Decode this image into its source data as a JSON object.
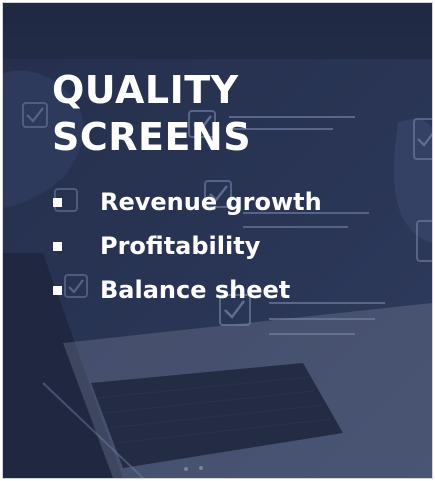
{
  "card": {
    "title_line1": "QUALITY",
    "title_line2": "SCREENS",
    "bullets": [
      "Revenue growth",
      "Profitability",
      "Balance sheet"
    ]
  },
  "colors": {
    "background_navy": "#2b3757",
    "text": "#ffffff",
    "checklist_lines": "#8ea0c8"
  },
  "icons": [
    "checkbox-check-icon",
    "bullet-square-icon"
  ]
}
